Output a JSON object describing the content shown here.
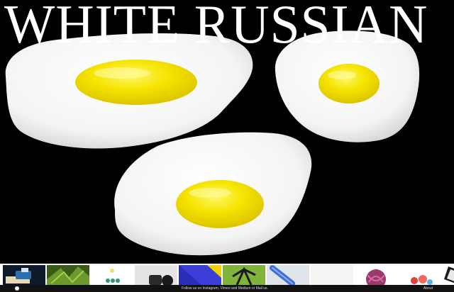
{
  "site": {
    "brand": "WHITE RUSSIAN"
  },
  "hero": {
    "image": "fried-eggs-render"
  },
  "gallery": [
    {
      "icon": "thumb-boat-scene"
    },
    {
      "icon": "thumb-palm-leaves"
    },
    {
      "icon": "thumb-cactus-pots"
    },
    {
      "icon": "thumb-black-device"
    },
    {
      "icon": "thumb-blue-diagonal"
    },
    {
      "icon": "thumb-dark-plant"
    },
    {
      "icon": "thumb-blue-tube"
    },
    {
      "icon": "thumb-empty"
    },
    {
      "icon": "thumb-yarn-ball"
    },
    {
      "icon": "thumb-red-candy"
    },
    {
      "icon": "thumb-phone-frame"
    }
  ],
  "footer": {
    "follow_text": "Follow us on Instagram, Vimeo and Medium or Mail us.",
    "about_label": "About"
  },
  "colors": {
    "background": "#000000",
    "egg_white": "#ffffff",
    "yolk": "#f3e000",
    "footer": "#111111"
  }
}
